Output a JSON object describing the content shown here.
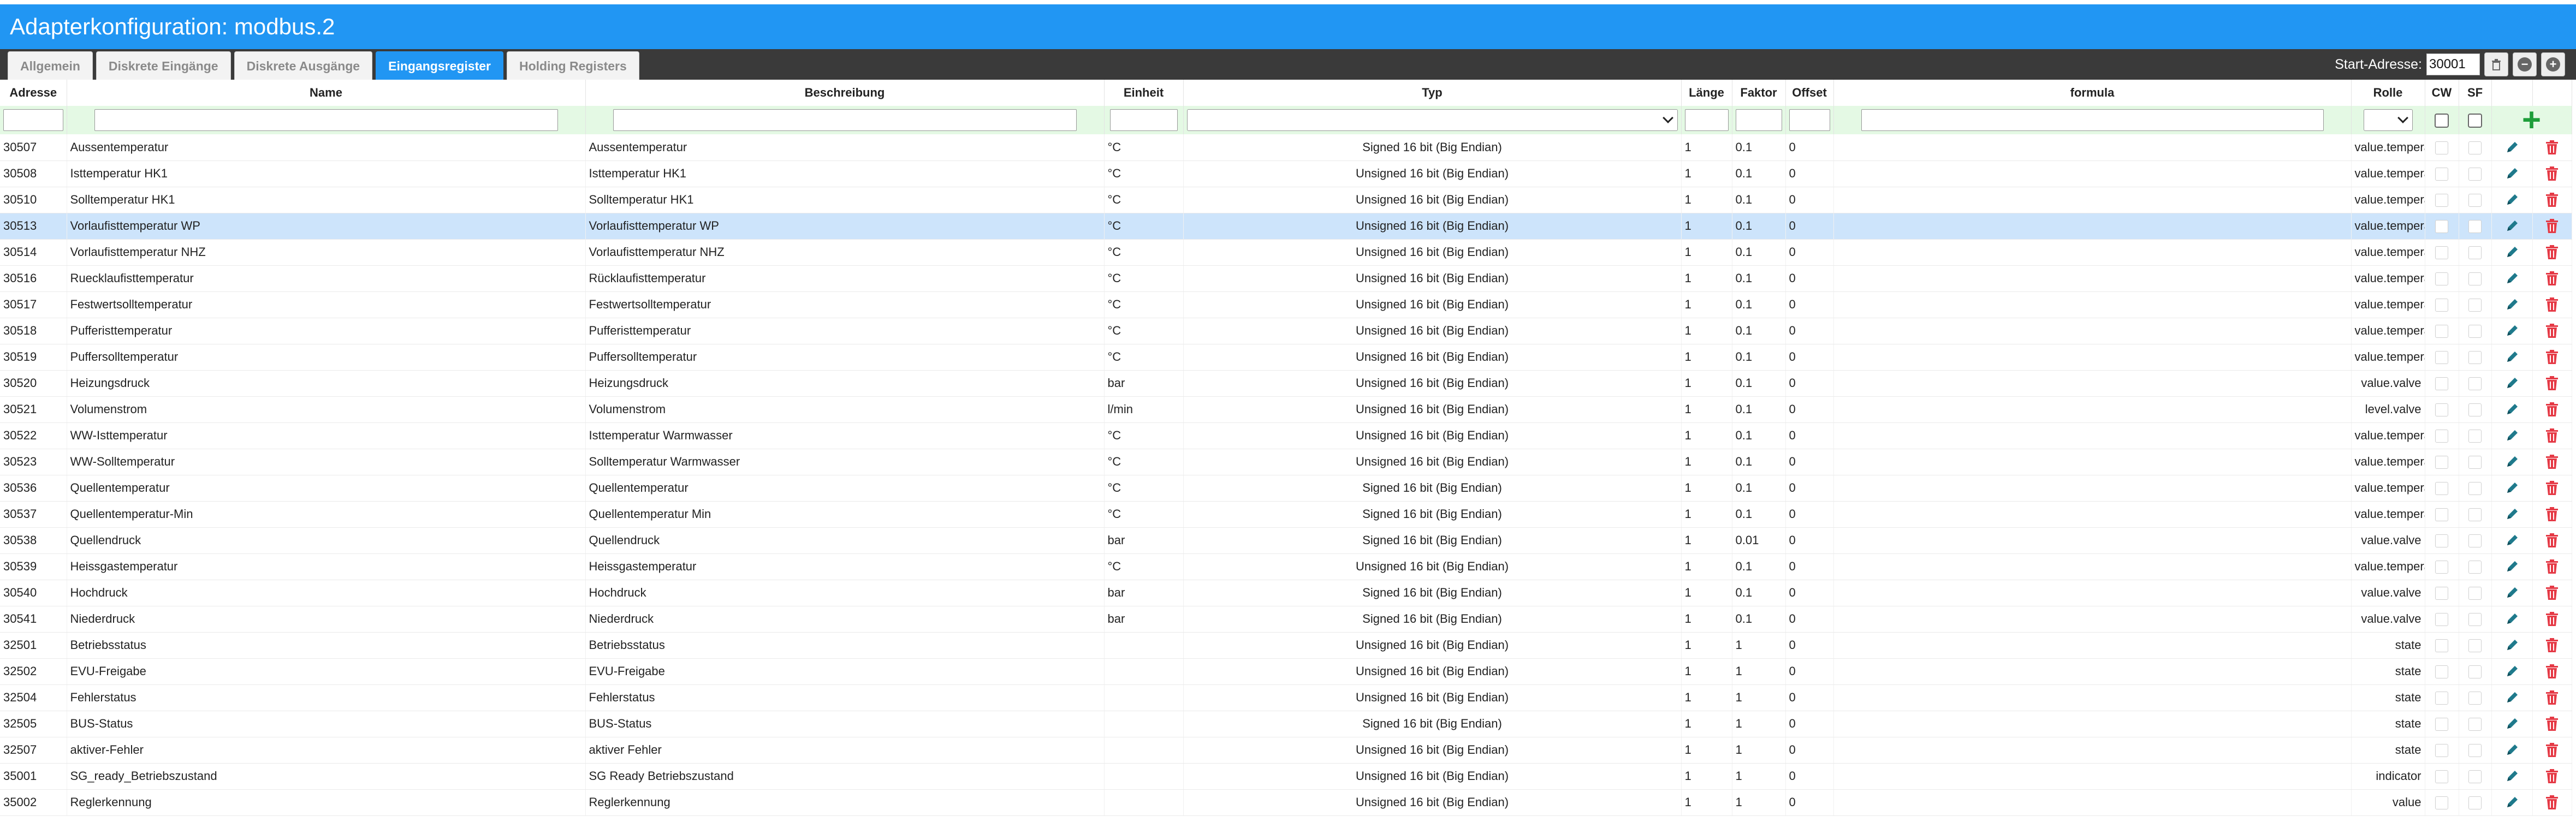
{
  "title": "Adapterkonfiguration: modbus.2",
  "tabs": [
    {
      "label": "Allgemein",
      "active": false
    },
    {
      "label": "Diskrete Eingänge",
      "active": false
    },
    {
      "label": "Diskrete Ausgänge",
      "active": false
    },
    {
      "label": "Eingangsregister",
      "active": true
    },
    {
      "label": "Holding Registers",
      "active": false
    }
  ],
  "start_address": {
    "label": "Start-Adresse:",
    "value": "30001"
  },
  "controls": {
    "delete_icon": "trash-icon",
    "collapse_icon": "minus-circle-icon",
    "add_icon": "plus-circle-icon"
  },
  "columns": {
    "address": "Adresse",
    "name": "Name",
    "description": "Beschreibung",
    "unit": "Einheit",
    "type": "Typ",
    "length": "Länge",
    "factor": "Faktor",
    "offset": "Offset",
    "formula": "formula",
    "role": "Rolle",
    "cw": "CW",
    "sf": "SF"
  },
  "colors": {
    "accent": "#2196f3",
    "filter_bg": "#e4f9e4",
    "selected_row": "#cde4fb",
    "edit_icon": "#1f7a8c",
    "delete_icon": "#e53945",
    "add_icon": "#1e9e3a"
  },
  "rows": [
    {
      "address": "30507",
      "name": "Aussentemperatur",
      "description": "Aussentemperatur",
      "unit": "°C",
      "type": "Signed 16 bit (Big Endian)",
      "length": "1",
      "factor": "0.1",
      "offset": "0",
      "formula": "",
      "role": "value.temperature"
    },
    {
      "address": "30508",
      "name": "Isttemperatur HK1",
      "description": "Isttemperatur HK1",
      "unit": "°C",
      "type": "Unsigned 16 bit (Big Endian)",
      "length": "1",
      "factor": "0.1",
      "offset": "0",
      "formula": "",
      "role": "value.temperature"
    },
    {
      "address": "30510",
      "name": "Solltemperatur HK1",
      "description": "Solltemperatur HK1",
      "unit": "°C",
      "type": "Unsigned 16 bit (Big Endian)",
      "length": "1",
      "factor": "0.1",
      "offset": "0",
      "formula": "",
      "role": "value.temperature"
    },
    {
      "address": "30513",
      "name": "Vorlaufisttemperatur WP",
      "description": "Vorlaufisttemperatur WP",
      "unit": "°C",
      "type": "Unsigned 16 bit (Big Endian)",
      "length": "1",
      "factor": "0.1",
      "offset": "0",
      "formula": "",
      "role": "value.temperature",
      "selected": true
    },
    {
      "address": "30514",
      "name": "Vorlaufisttemperatur NHZ",
      "description": "Vorlaufisttemperatur NHZ",
      "unit": "°C",
      "type": "Unsigned 16 bit (Big Endian)",
      "length": "1",
      "factor": "0.1",
      "offset": "0",
      "formula": "",
      "role": "value.temperature"
    },
    {
      "address": "30516",
      "name": "Ruecklaufisttemperatur",
      "description": "Rücklaufisttemperatur",
      "unit": "°C",
      "type": "Unsigned 16 bit (Big Endian)",
      "length": "1",
      "factor": "0.1",
      "offset": "0",
      "formula": "",
      "role": "value.temperature"
    },
    {
      "address": "30517",
      "name": "Festwertsolltemperatur",
      "description": "Festwertsolltemperatur",
      "unit": "°C",
      "type": "Unsigned 16 bit (Big Endian)",
      "length": "1",
      "factor": "0.1",
      "offset": "0",
      "formula": "",
      "role": "value.temperature"
    },
    {
      "address": "30518",
      "name": "Pufferisttemperatur",
      "description": "Pufferisttemperatur",
      "unit": "°C",
      "type": "Unsigned 16 bit (Big Endian)",
      "length": "1",
      "factor": "0.1",
      "offset": "0",
      "formula": "",
      "role": "value.temperature"
    },
    {
      "address": "30519",
      "name": "Puffersolltemperatur",
      "description": "Puffersolltemperatur",
      "unit": "°C",
      "type": "Unsigned 16 bit (Big Endian)",
      "length": "1",
      "factor": "0.1",
      "offset": "0",
      "formula": "",
      "role": "value.temperature"
    },
    {
      "address": "30520",
      "name": "Heizungsdruck",
      "description": "Heizungsdruck",
      "unit": "bar",
      "type": "Unsigned 16 bit (Big Endian)",
      "length": "1",
      "factor": "0.1",
      "offset": "0",
      "formula": "",
      "role": "value.valve"
    },
    {
      "address": "30521",
      "name": "Volumenstrom",
      "description": "Volumenstrom",
      "unit": "l/min",
      "type": "Unsigned 16 bit (Big Endian)",
      "length": "1",
      "factor": "0.1",
      "offset": "0",
      "formula": "",
      "role": "level.valve"
    },
    {
      "address": "30522",
      "name": "WW-Isttemperatur",
      "description": "Isttemperatur Warmwasser",
      "unit": "°C",
      "type": "Unsigned 16 bit (Big Endian)",
      "length": "1",
      "factor": "0.1",
      "offset": "0",
      "formula": "",
      "role": "value.temperature"
    },
    {
      "address": "30523",
      "name": "WW-Solltemperatur",
      "description": "Solltemperatur Warmwasser",
      "unit": "°C",
      "type": "Unsigned 16 bit (Big Endian)",
      "length": "1",
      "factor": "0.1",
      "offset": "0",
      "formula": "",
      "role": "value.temperature"
    },
    {
      "address": "30536",
      "name": "Quellentemperatur",
      "description": "Quellentemperatur",
      "unit": "°C",
      "type": "Signed 16 bit (Big Endian)",
      "length": "1",
      "factor": "0.1",
      "offset": "0",
      "formula": "",
      "role": "value.temperature"
    },
    {
      "address": "30537",
      "name": "Quellentemperatur-Min",
      "description": "Quellentemperatur Min",
      "unit": "°C",
      "type": "Signed 16 bit (Big Endian)",
      "length": "1",
      "factor": "0.1",
      "offset": "0",
      "formula": "",
      "role": "value.temperature"
    },
    {
      "address": "30538",
      "name": "Quellendruck",
      "description": "Quellendruck",
      "unit": "bar",
      "type": "Signed 16 bit (Big Endian)",
      "length": "1",
      "factor": "0.01",
      "offset": "0",
      "formula": "",
      "role": "value.valve"
    },
    {
      "address": "30539",
      "name": "Heissgastemperatur",
      "description": "Heissgastemperatur",
      "unit": "°C",
      "type": "Unsigned 16 bit (Big Endian)",
      "length": "1",
      "factor": "0.1",
      "offset": "0",
      "formula": "",
      "role": "value.temperature"
    },
    {
      "address": "30540",
      "name": "Hochdruck",
      "description": "Hochdruck",
      "unit": "bar",
      "type": "Signed 16 bit (Big Endian)",
      "length": "1",
      "factor": "0.1",
      "offset": "0",
      "formula": "",
      "role": "value.valve"
    },
    {
      "address": "30541",
      "name": "Niederdruck",
      "description": "Niederdruck",
      "unit": "bar",
      "type": "Signed 16 bit (Big Endian)",
      "length": "1",
      "factor": "0.1",
      "offset": "0",
      "formula": "",
      "role": "value.valve"
    },
    {
      "address": "32501",
      "name": "Betriebsstatus",
      "description": "Betriebsstatus",
      "unit": "",
      "type": "Unsigned 16 bit (Big Endian)",
      "length": "1",
      "factor": "1",
      "offset": "0",
      "formula": "",
      "role": "state"
    },
    {
      "address": "32502",
      "name": "EVU-Freigabe",
      "description": "EVU-Freigabe",
      "unit": "",
      "type": "Unsigned 16 bit (Big Endian)",
      "length": "1",
      "factor": "1",
      "offset": "0",
      "formula": "",
      "role": "state"
    },
    {
      "address": "32504",
      "name": "Fehlerstatus",
      "description": "Fehlerstatus",
      "unit": "",
      "type": "Unsigned 16 bit (Big Endian)",
      "length": "1",
      "factor": "1",
      "offset": "0",
      "formula": "",
      "role": "state"
    },
    {
      "address": "32505",
      "name": "BUS-Status",
      "description": "BUS-Status",
      "unit": "",
      "type": "Signed 16 bit (Big Endian)",
      "length": "1",
      "factor": "1",
      "offset": "0",
      "formula": "",
      "role": "state"
    },
    {
      "address": "32507",
      "name": "aktiver-Fehler",
      "description": "aktiver Fehler",
      "unit": "",
      "type": "Unsigned 16 bit (Big Endian)",
      "length": "1",
      "factor": "1",
      "offset": "0",
      "formula": "",
      "role": "state"
    },
    {
      "address": "35001",
      "name": "SG_ready_Betriebszustand",
      "description": "SG Ready Betriebszustand",
      "unit": "",
      "type": "Unsigned 16 bit (Big Endian)",
      "length": "1",
      "factor": "1",
      "offset": "0",
      "formula": "",
      "role": "indicator"
    },
    {
      "address": "35002",
      "name": "Reglerkennung",
      "description": "Reglerkennung",
      "unit": "",
      "type": "Unsigned 16 bit (Big Endian)",
      "length": "1",
      "factor": "1",
      "offset": "0",
      "formula": "",
      "role": "value"
    }
  ]
}
